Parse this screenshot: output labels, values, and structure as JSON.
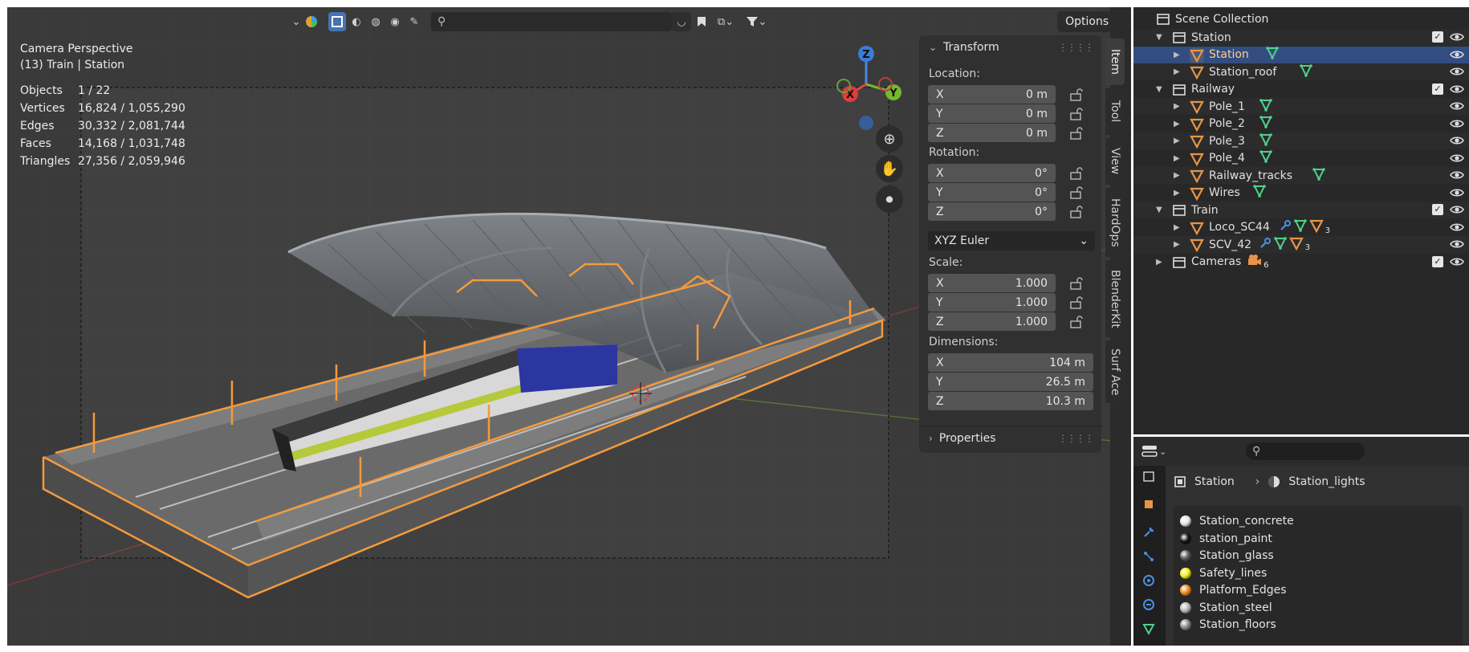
{
  "viewport": {
    "overlay": {
      "camera": "Camera Perspective",
      "context": "(13) Train | Station",
      "stats": [
        {
          "label": "Objects",
          "value": "1 / 22"
        },
        {
          "label": "Vertices",
          "value": "16,824 / 1,055,290"
        },
        {
          "label": "Edges",
          "value": "30,332 / 2,081,744"
        },
        {
          "label": "Faces",
          "value": "14,168 / 1,031,748"
        },
        {
          "label": "Triangles",
          "value": "27,356 / 2,059,946"
        }
      ]
    },
    "options_label": "Options",
    "gizmo": {
      "x": "X",
      "y": "Y",
      "z": "Z"
    }
  },
  "npanel": {
    "tabs": [
      "Item",
      "Tool",
      "View",
      "HardOps",
      "BlenderKit",
      "Surf Ace"
    ],
    "active_tab": "Item",
    "transform_title": "Transform",
    "location_label": "Location:",
    "location": [
      {
        "axis": "X",
        "value": "0 m"
      },
      {
        "axis": "Y",
        "value": "0 m"
      },
      {
        "axis": "Z",
        "value": "0 m"
      }
    ],
    "rotation_label": "Rotation:",
    "rotation": [
      {
        "axis": "X",
        "value": "0°"
      },
      {
        "axis": "Y",
        "value": "0°"
      },
      {
        "axis": "Z",
        "value": "0°"
      }
    ],
    "rotation_mode": "XYZ Euler",
    "scale_label": "Scale:",
    "scale": [
      {
        "axis": "X",
        "value": "1.000"
      },
      {
        "axis": "Y",
        "value": "1.000"
      },
      {
        "axis": "Z",
        "value": "1.000"
      }
    ],
    "dimensions_label": "Dimensions:",
    "dimensions": [
      {
        "axis": "X",
        "value": "104 m"
      },
      {
        "axis": "Y",
        "value": "26.5 m"
      },
      {
        "axis": "Z",
        "value": "10.3 m"
      }
    ],
    "properties_title": "Properties"
  },
  "outliner": {
    "root": "Scene Collection",
    "rows": [
      {
        "name": "Station",
        "kind": "collection",
        "checked": true
      },
      {
        "name": "Station",
        "kind": "object",
        "selected": true
      },
      {
        "name": "Station_roof",
        "kind": "object"
      },
      {
        "name": "Railway",
        "kind": "collection",
        "checked": true
      },
      {
        "name": "Pole_1",
        "kind": "object"
      },
      {
        "name": "Pole_2",
        "kind": "object"
      },
      {
        "name": "Pole_3",
        "kind": "object"
      },
      {
        "name": "Pole_4",
        "kind": "object"
      },
      {
        "name": "Railway_tracks",
        "kind": "object"
      },
      {
        "name": "Wires",
        "kind": "object"
      },
      {
        "name": "Train",
        "kind": "collection",
        "checked": true
      },
      {
        "name": "Loco_SC44",
        "kind": "object",
        "modifier": true,
        "count": "3"
      },
      {
        "name": "SCV_42",
        "kind": "object",
        "modifier": true,
        "count": "3"
      },
      {
        "name": "Cameras",
        "kind": "collection",
        "checked": true,
        "camera_count": "6"
      }
    ]
  },
  "properties": {
    "breadcrumb_object": "Station",
    "breadcrumb_material": "Station_lights",
    "materials": [
      {
        "name": "Station_concrete",
        "color": "#e8e8e8"
      },
      {
        "name": "station_paint",
        "color": "#111111"
      },
      {
        "name": "Station_glass",
        "color": "#5a5a5a"
      },
      {
        "name": "Safety_lines",
        "color": "#f5ee10"
      },
      {
        "name": "Platform_Edges",
        "color": "#f08a18"
      },
      {
        "name": "Station_steel",
        "color": "#b8b8b8"
      },
      {
        "name": "Station_floors",
        "color": "#8a8a8a"
      }
    ]
  },
  "colors": {
    "accent": "#4772b3",
    "selection_outline": "#f59a3b",
    "object_icon": "#e8944a",
    "mesh_data_icon": "#4fd08a",
    "modifier_icon": "#4a90e2"
  }
}
